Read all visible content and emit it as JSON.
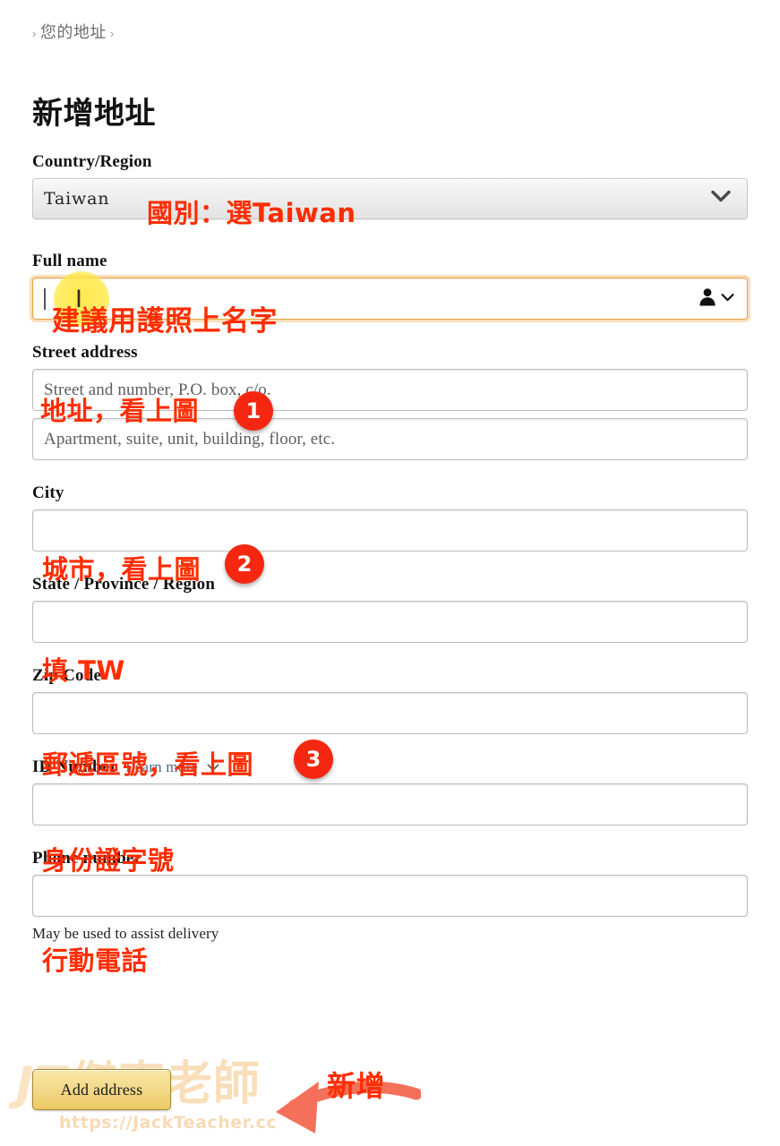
{
  "breadcrumb": {
    "leading_chevron": "›",
    "label": "您的地址",
    "trailing_chevron": "›"
  },
  "page_title": "新增地址",
  "form": {
    "country": {
      "label": "Country/Region",
      "value": "Taiwan",
      "chevron": "∨"
    },
    "full_name": {
      "label": "Full name",
      "value": "",
      "placeholder": "",
      "autofill_icon": "person-icon",
      "autofill_chevron": "∨"
    },
    "street_address": {
      "label": "Street address",
      "placeholder": "Street and number, P.O. box, c/o."
    },
    "street_address2": {
      "placeholder": "Apartment, suite, unit, building, floor, etc."
    },
    "city": {
      "label": "City",
      "placeholder": ""
    },
    "state": {
      "label": "State / Province / Region",
      "placeholder": ""
    },
    "zip": {
      "label": "Zip Code",
      "placeholder": ""
    },
    "id_number": {
      "label": "ID Number",
      "learn_more": "Learn more",
      "learn_more_chevron": "∨",
      "placeholder": ""
    },
    "phone": {
      "label": "Phone number",
      "placeholder": "",
      "helper": "May be used to assist delivery"
    },
    "submit": {
      "label": "Add address"
    }
  },
  "annotations": {
    "color": "#FF2D00",
    "badge_color": "#F62711",
    "arrow_color": "#F4705B",
    "highlight_color": "#FFE840",
    "country": "國別：選Taiwan",
    "full_name": "建議用護照上名字",
    "street_address": "地址，看上圖",
    "city": "城市，看上圖",
    "state": "填 TW",
    "zip": "郵遞區號，看上圖",
    "id_number": "身份證字號",
    "phone": "行動電話",
    "submit": "新增",
    "badges": [
      "1",
      "2",
      "3"
    ],
    "cursor_glyph": "I"
  },
  "watermark": {
    "initials": "JT",
    "name": "傑克老師",
    "url": "https://JackTeacher.cc"
  }
}
